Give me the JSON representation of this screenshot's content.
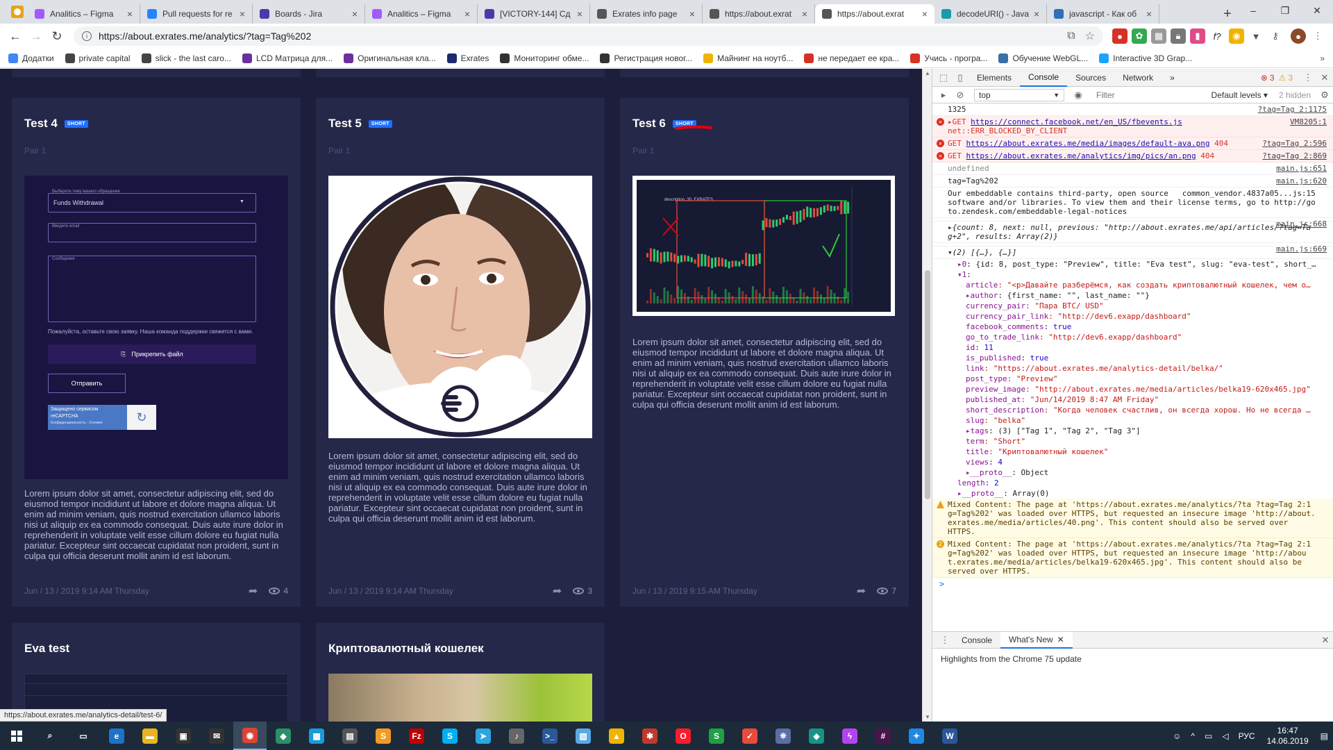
{
  "browser": {
    "tabs": [
      {
        "title": "Analitics – Figma",
        "color": "#a259ff"
      },
      {
        "title": "Pull requests for re",
        "color": "#2684ff"
      },
      {
        "title": "Boards - Jira",
        "color": "#4a3aa8"
      },
      {
        "title": "Analitics – Figma",
        "color": "#a259ff"
      },
      {
        "title": "[VICTORY-144] Сд",
        "color": "#4a3aa8"
      },
      {
        "title": "Exrates info page",
        "color": "#555"
      },
      {
        "title": "https://about.exrat",
        "color": "#555"
      },
      {
        "title": "https://about.exrat",
        "color": "#555",
        "active": true
      },
      {
        "title": "decodeURI() - Java",
        "color": "#1b9aaa"
      },
      {
        "title": "javascript - Как об",
        "color": "#2f6fb6"
      }
    ],
    "new_tab": "+",
    "window_controls": [
      "–",
      "❐",
      "✕"
    ],
    "url": "https://about.exrates.me/analytics/?tag=Tag%202",
    "bookmarks": [
      {
        "label": "Додатки",
        "color": "#4285f4"
      },
      {
        "label": "private capital",
        "color": "#444"
      },
      {
        "label": "slick - the last caro...",
        "color": "#444"
      },
      {
        "label": "LCD Матрица для...",
        "color": "#6b2fa0"
      },
      {
        "label": "Оригинальная кла...",
        "color": "#6b2fa0"
      },
      {
        "label": "Exrates",
        "color": "#1a2a6c"
      },
      {
        "label": "Мониторинг обме...",
        "color": "#333"
      },
      {
        "label": "Регистрация новог...",
        "color": "#333"
      },
      {
        "label": "Майнинг на ноутб...",
        "color": "#f0b400"
      },
      {
        "label": "не передает ее кра...",
        "color": "#d93025"
      },
      {
        "label": "Учись - програ...",
        "color": "#d93025"
      },
      {
        "label": "Обучение WebGL...",
        "color": "#3a6ea5"
      },
      {
        "label": "Interactive 3D Grap...",
        "color": "#1aa3ff"
      }
    ],
    "bookmarks_more": "»"
  },
  "cards": [
    {
      "title": "Test 4",
      "badge": "SHORT",
      "pair": "Pair 1",
      "desc": "Lorem ipsum dolor sit amet, consectetur adipiscing elit, sed do eiusmod tempor incididunt ut labore et dolore magna aliqua. Ut enim ad minim veniam, quis nostrud exercitation ullamco laboris nisi ut aliquip ex ea commodo consequat. Duis aute irure dolor in reprehenderit in voluptate velit esse cillum dolore eu fugiat nulla pariatur. Excepteur sint occaecat cupidatat non proident, sunt in culpa qui officia deserunt mollit anim id est laborum.",
      "date": "Jun / 13 / 2019 9:14 AM Thursday",
      "views": "4",
      "form": {
        "select_label": "Выберите тему вашего обращения",
        "select_value": "Funds Withdrawal",
        "email_label": "Введите email",
        "message_label": "Сообщение",
        "hint": "Пожалуйста, оставьте свою заявку. Наша команда поддержки свяжется с вами.",
        "attach": "Прикрепить файл",
        "submit": "Отправить",
        "captcha_1": "Защищено сервисом",
        "captcha_2": "reCAPTCHA",
        "captcha_3": "Конфиденциальность - Условия"
      }
    },
    {
      "title": "Test 5",
      "badge": "SHORT",
      "pair": "Pair 1",
      "desc": "Lorem ipsum dolor sit amet, consectetur adipiscing elit, sed do eiusmod tempor incididunt ut labore et dolore magna aliqua. Ut enim ad minim veniam, quis nostrud exercitation ullamco laboris nisi ut aliquip ex ea commodo consequat. Duis aute irure dolor in reprehenderit in voluptate velit esse cillum dolore eu fugiat nulla pariatur. Excepteur sint occaecat cupidatat non proident, sunt in culpa qui officia deserunt mollit anim id est laborum.",
      "date": "Jun / 13 / 2019 9:14 AM Thursday",
      "views": "3"
    },
    {
      "title": "Test 6",
      "badge": "SHORT",
      "pair": "Pair 1",
      "desc": "Lorem ipsum dolor sit amet, consectetur adipiscing elit, sed do eiusmod tempor incididunt ut labore et dolore magna aliqua. Ut enim ad minim veniam, quis nostrud exercitation ullamco laboris nisi ut aliquip ex ea commodo consequat. Duis aute irure dolor in reprehenderit in voluptate velit esse cillum dolore eu fugiat nulla pariatur. Excepteur sint occaecat cupidatat non proident, sunt in culpa qui officia deserunt mollit anim id est laborum.",
      "date": "Jun / 13 / 2019 9:15 AM Thursday",
      "views": "7",
      "chart_label": "description, 30, EXRATES"
    },
    {
      "title": "Eva test"
    },
    {
      "title": "Криптовалютный кошелек"
    }
  ],
  "status_url": "https://about.exrates.me/analytics-detail/test-6/",
  "devtools": {
    "tabs": [
      "Elements",
      "Console",
      "Sources",
      "Network"
    ],
    "active_tab": "Console",
    "more": "»",
    "errors": "3",
    "warnings": "3",
    "context": "top",
    "filter_placeholder": "Filter",
    "levels": "Default levels ▾",
    "hidden": "2 hidden",
    "lines": [
      {
        "type": "log",
        "text": "1325",
        "src": "?tag=Tag 2:1175"
      },
      {
        "type": "err",
        "prefix": "▸GET ",
        "link": "https://connect.facebook.net/en_US/fbevents.js",
        "text": "\nnet::ERR_BLOCKED_BY_CLIENT",
        "src": "VM8205:1"
      },
      {
        "type": "err",
        "prefix": "GET ",
        "link": "https://about.exrates.me/media/images/default-ava.png",
        "text": " 404",
        "src": "?tag=Tag 2:596"
      },
      {
        "type": "err",
        "prefix": "GET ",
        "link": "https://about.exrates.me/analytics/img/pics/an.png",
        "text": " 404",
        "src": "?tag=Tag 2:869"
      },
      {
        "type": "log",
        "text": "undefined",
        "src": "main.js:651",
        "muted": true
      },
      {
        "type": "log",
        "text": "tag=Tag%202",
        "src": "main.js:620"
      },
      {
        "type": "log",
        "text": "Our embeddable contains third-party, open source   common_vendor.4837a05...js:15\nsoftware and/or libraries. To view them and their license terms, go to http://go\nto.zendesk.com/embeddable-legal-notices",
        "src": ""
      },
      {
        "type": "log",
        "text": "",
        "src": "main.js:668"
      },
      {
        "type": "obj",
        "text": "▸{count: 8, next: null, previous: \"http://about.exrates.me/api/articles/?tag=Ta\ng+2\", results: Array(2)}"
      },
      {
        "type": "log",
        "text": "",
        "src": "main.js:669"
      },
      {
        "type": "obj",
        "text": "▾(2) [{…}, {…}]"
      }
    ],
    "tree": [
      {
        "lvl": "l2",
        "k": "▸0",
        "v": ": {id: 8, post_type: \"Preview\", title: \"Eva test\", slug: \"eva-test\", short_…"
      },
      {
        "lvl": "l2",
        "k": "▾1",
        "v": ":"
      },
      {
        "lvl": "",
        "k": "article",
        "v": ": \"<p>Давайте разберёмся, как создать криптовалютный кошелек, чем о…",
        "t": "s"
      },
      {
        "lvl": "",
        "k": "▸author",
        "v": ": {first_name: \"\", last_name: \"\"}"
      },
      {
        "lvl": "",
        "k": "currency_pair",
        "v": ": \"Пара BTC/ USD\"",
        "t": "s"
      },
      {
        "lvl": "",
        "k": "currency_pair_link",
        "v": ": \"http://dev6.exapp/dashboard\"",
        "t": "s"
      },
      {
        "lvl": "",
        "k": "facebook_comments",
        "v": ": true",
        "t": "n"
      },
      {
        "lvl": "",
        "k": "go_to_trade_link",
        "v": ": \"http://dev6.exapp/dashboard\"",
        "t": "s"
      },
      {
        "lvl": "",
        "k": "id",
        "v": ": 11",
        "t": "n"
      },
      {
        "lvl": "",
        "k": "is_published",
        "v": ": true",
        "t": "n"
      },
      {
        "lvl": "",
        "k": "link",
        "v": ": \"https://about.exrates.me/analytics-detail/belka/\"",
        "t": "s"
      },
      {
        "lvl": "",
        "k": "post_type",
        "v": ": \"Preview\"",
        "t": "s"
      },
      {
        "lvl": "",
        "k": "preview_image",
        "v": ": \"http://about.exrates.me/media/articles/belka19-620x465.jpg\"",
        "t": "s"
      },
      {
        "lvl": "",
        "k": "published_at",
        "v": ": \"Jun/14/2019 8:47 AM Friday\"",
        "t": "s"
      },
      {
        "lvl": "",
        "k": "short_description",
        "v": ": \"Когда человек счастлив, он всегда хорош. Но не всегда …",
        "t": "s"
      },
      {
        "lvl": "",
        "k": "slug",
        "v": ": \"belka\"",
        "t": "s"
      },
      {
        "lvl": "",
        "k": "▸tags",
        "v": ": (3) [\"Tag 1\", \"Tag 2\", \"Tag 3\"]"
      },
      {
        "lvl": "",
        "k": "term",
        "v": ": \"Short\"",
        "t": "s"
      },
      {
        "lvl": "",
        "k": "title",
        "v": ": \"Криптовалютный кошелек\"",
        "t": "s"
      },
      {
        "lvl": "",
        "k": "views",
        "v": ": 4",
        "t": "n"
      },
      {
        "lvl": "",
        "k": "▸__proto__",
        "v": ": Object"
      },
      {
        "lvl": "l2",
        "k": "length",
        "v": ": 2",
        "t": "n"
      },
      {
        "lvl": "l2",
        "k": "▸__proto__",
        "v": ": Array(0)"
      }
    ],
    "warnings_list": [
      {
        "text": "Mixed Content: The page at 'https://about.exrates.me/analytics/?ta ?tag=Tag 2:1\ng=Tag%202' was loaded over HTTPS, but requested an insecure image 'http://about.\nexrates.me/media/articles/40.png'. This content should also be served over\nHTTPS."
      },
      {
        "text": "Mixed Content: The page at 'https://about.exrates.me/analytics/?ta ?tag=Tag 2:1\ng=Tag%202' was loaded over HTTPS, but requested an insecure image 'http://abou\nt.exrates.me/media/articles/belka19-620x465.jpg'. This content should also be\nserved over HTTPS.",
        "count": "2"
      }
    ],
    "prompt": ">",
    "drawer_tabs": [
      "Console",
      "What's New"
    ],
    "drawer_text": "Highlights from the Chrome 75 update"
  },
  "taskbar": {
    "apps": [
      {
        "name": "search",
        "glyph": "⌕",
        "color": "transparent"
      },
      {
        "name": "task-view",
        "glyph": "▭",
        "color": "transparent"
      },
      {
        "name": "edge",
        "glyph": "e",
        "color": "#1e73c8"
      },
      {
        "name": "explorer",
        "glyph": "▬",
        "color": "#e8b520"
      },
      {
        "name": "store",
        "glyph": "▣",
        "color": "#333"
      },
      {
        "name": "mail",
        "glyph": "✉",
        "color": "#333"
      },
      {
        "name": "chrome",
        "glyph": "◉",
        "color": "#db4437",
        "active": true
      },
      {
        "name": "app-green",
        "glyph": "◆",
        "color": "#2a8f6a"
      },
      {
        "name": "app-cyan",
        "glyph": "▦",
        "color": "#1a9bd7"
      },
      {
        "name": "calculator",
        "glyph": "▤",
        "color": "#555"
      },
      {
        "name": "sublime",
        "glyph": "S",
        "color": "#f29b24"
      },
      {
        "name": "filezilla",
        "glyph": "Fz",
        "color": "#bf0000"
      },
      {
        "name": "skype",
        "glyph": "S",
        "color": "#00aff0"
      },
      {
        "name": "telegram",
        "glyph": "➤",
        "color": "#2ca5e0"
      },
      {
        "name": "mic",
        "glyph": "♪",
        "color": "#666"
      },
      {
        "name": "powershell",
        "glyph": ">_",
        "color": "#2b5797"
      },
      {
        "name": "notepad",
        "glyph": "▧",
        "color": "#5aa9e6"
      },
      {
        "name": "app-yellow",
        "glyph": "▲",
        "color": "#f0b400"
      },
      {
        "name": "app-red",
        "glyph": "✱",
        "color": "#c0392b"
      },
      {
        "name": "opera",
        "glyph": "O",
        "color": "#ff1b2d"
      },
      {
        "name": "app-s",
        "glyph": "S",
        "color": "#1fa045"
      },
      {
        "name": "app-check",
        "glyph": "✓",
        "color": "#e84a3c"
      },
      {
        "name": "app-net",
        "glyph": "⎈",
        "color": "#5a6ea5"
      },
      {
        "name": "gitkraken",
        "glyph": "◈",
        "color": "#179287"
      },
      {
        "name": "phpstorm",
        "glyph": "ϟ",
        "color": "#b345f1"
      },
      {
        "name": "slack",
        "glyph": "#",
        "color": "#4a154b"
      },
      {
        "name": "app-blue",
        "glyph": "✦",
        "color": "#1e88e5"
      },
      {
        "name": "word",
        "glyph": "W",
        "color": "#2b579a"
      }
    ],
    "tray": {
      "lang": "РУС",
      "time": "16:47",
      "date": "14.06.2019"
    }
  }
}
